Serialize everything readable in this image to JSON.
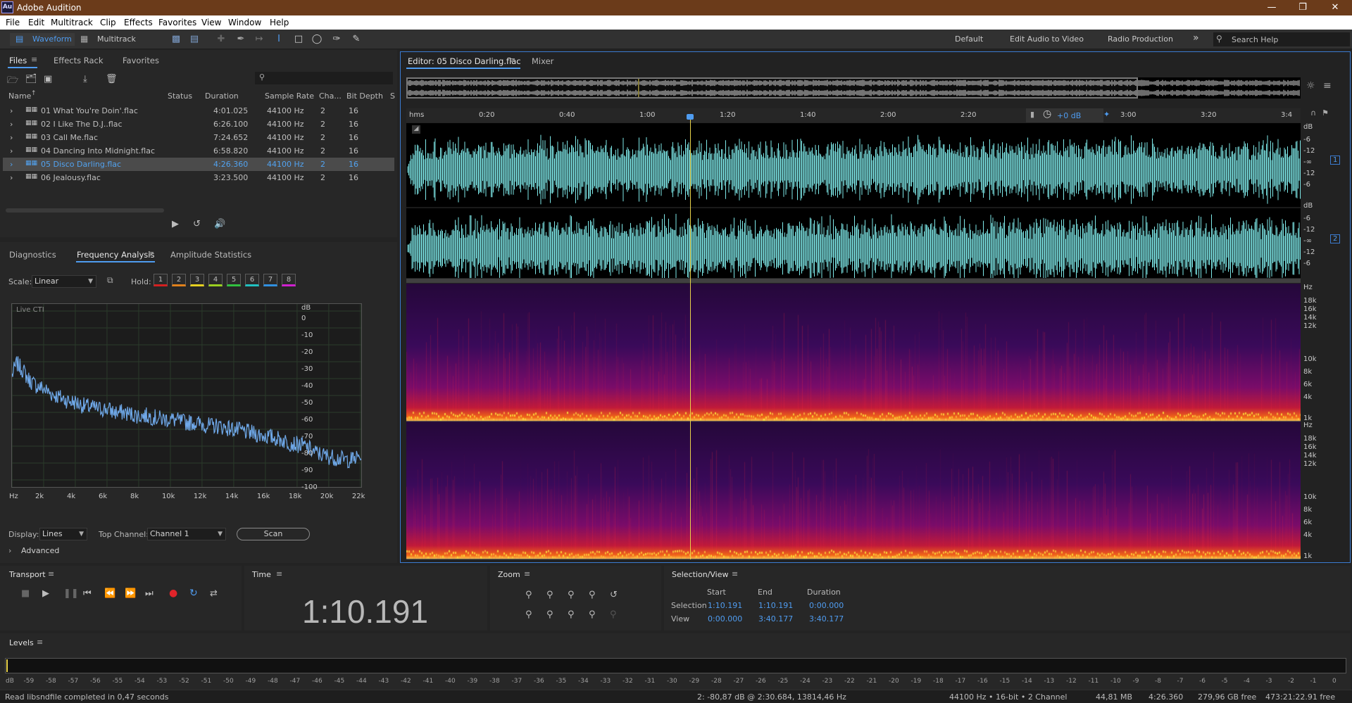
{
  "app": {
    "title": "Adobe Audition",
    "logo_text": "Au",
    "window_controls": [
      "minimize-icon",
      "maximize-icon",
      "close-icon"
    ]
  },
  "menu": [
    "File",
    "Edit",
    "Multitrack",
    "Clip",
    "Effects",
    "Favorites",
    "View",
    "Window",
    "Help"
  ],
  "toolbar": {
    "waveform_label": "Waveform",
    "multitrack_label": "Multitrack",
    "workspaces": [
      "Default",
      "Edit Audio to Video",
      "Radio Production"
    ],
    "search_placeholder": "Search Help"
  },
  "files_panel": {
    "tabs": [
      "Files",
      "Effects Rack",
      "Favorites"
    ],
    "search_placeholder": "",
    "columns": [
      "Name",
      "Status",
      "Duration",
      "Sample Rate",
      "Cha...",
      "Bit Depth",
      "S"
    ],
    "rows": [
      {
        "name": "01 What You're Doin'.flac",
        "status": "",
        "duration": "4:01.025",
        "sample_rate": "44100 Hz",
        "channels": "2",
        "bit_depth": "16"
      },
      {
        "name": "02 I Like The D.J..flac",
        "status": "",
        "duration": "6:26.100",
        "sample_rate": "44100 Hz",
        "channels": "2",
        "bit_depth": "16"
      },
      {
        "name": "03 Call Me.flac",
        "status": "",
        "duration": "7:24.652",
        "sample_rate": "44100 Hz",
        "channels": "2",
        "bit_depth": "16"
      },
      {
        "name": "04 Dancing Into Midnight.flac",
        "status": "",
        "duration": "6:58.820",
        "sample_rate": "44100 Hz",
        "channels": "2",
        "bit_depth": "16"
      },
      {
        "name": "05 Disco Darling.flac",
        "status": "",
        "duration": "4:26.360",
        "sample_rate": "44100 Hz",
        "channels": "2",
        "bit_depth": "16",
        "selected": true
      },
      {
        "name": "06 Jealousy.flac",
        "status": "",
        "duration": "3:23.500",
        "sample_rate": "44100 Hz",
        "channels": "2",
        "bit_depth": "16"
      }
    ]
  },
  "analysis_panel": {
    "tabs": [
      "Diagnostics",
      "Frequency Analysis",
      "Amplitude Statistics"
    ],
    "scale_label": "Scale:",
    "scale_value": "Linear",
    "hold_label": "Hold:",
    "hold_buttons": [
      "1",
      "2",
      "3",
      "4",
      "5",
      "6",
      "7",
      "8"
    ],
    "hold_colors": [
      "#d42020",
      "#e0801b",
      "#e6d020",
      "#9bd020",
      "#31c040",
      "#20c0c0",
      "#3090e0",
      "#d020d0"
    ],
    "live_label": "Live CTI",
    "display_label": "Display:",
    "display_value": "Lines",
    "top_channel_label": "Top Channel:",
    "top_channel_value": "Channel 1",
    "scan_label": "Scan",
    "advanced_label": "Advanced"
  },
  "chart_data": {
    "type": "line",
    "title": "",
    "xlabel": "Hz",
    "ylabel": "dB",
    "x_ticks": [
      "Hz",
      "2k",
      "4k",
      "6k",
      "8k",
      "10k",
      "12k",
      "14k",
      "16k",
      "18k",
      "20k",
      "22k"
    ],
    "y_ticks": [
      "dB",
      "0",
      "-10",
      "-20",
      "-30",
      "-40",
      "-50",
      "-60",
      "-70",
      "-80",
      "-90",
      "-100"
    ],
    "xlim": [
      0,
      22050
    ],
    "ylim": [
      -100,
      0
    ],
    "grid": true,
    "series": [
      {
        "x": [
          0,
          300,
          700,
          1000,
          1500,
          2000,
          2500,
          3000,
          3500,
          4000,
          4500,
          5000,
          5500,
          6000,
          6500,
          7000,
          7500,
          8000,
          8500,
          9000,
          9500,
          10000,
          10500,
          11000,
          11500,
          12000,
          12500,
          13000,
          13500,
          14000,
          14500,
          15000,
          15500,
          16000,
          16500,
          17000,
          17500,
          18000,
          18500,
          19000,
          19500,
          20000,
          20500,
          21000,
          21500,
          22000
        ],
        "y": [
          -38,
          -31,
          -35,
          -40,
          -44,
          -46,
          -49,
          -51,
          -53,
          -54,
          -56,
          -57,
          -58,
          -58,
          -60,
          -60,
          -61,
          -62,
          -62,
          -63,
          -64,
          -64,
          -65,
          -66,
          -66,
          -67,
          -68,
          -68,
          -69,
          -70,
          -71,
          -72,
          -73,
          -74,
          -75,
          -76,
          -78,
          -79,
          -80,
          -83,
          -85,
          -86,
          -87,
          -88,
          -88,
          -86
        ]
      }
    ]
  },
  "editor": {
    "tabs": [
      "Editor: 05 Disco Darling.flac",
      "Mixer"
    ],
    "ruler_label": "hms",
    "ruler_ticks": [
      "0:20",
      "0:40",
      "1:00",
      "1:20",
      "1:40",
      "2:00",
      "2:20",
      "3:00",
      "3:20",
      "3:4"
    ],
    "hud_gain": "+0 dB",
    "db_scale_top": [
      "dB",
      "-6",
      "-12",
      "-∞",
      "-12",
      "-6"
    ],
    "db_scale_bottom": [
      "dB",
      "-6",
      "-12",
      "-∞",
      "-12",
      "-6"
    ],
    "hz_scale": [
      "Hz",
      "18k",
      "16k",
      "14k",
      "12k",
      "10k",
      "8k",
      "6k",
      "4k",
      "1k"
    ],
    "channel_tags": [
      "1",
      "2"
    ],
    "playhead_fraction": 0.3175,
    "waveform_color": "#7ee9e9"
  },
  "transport": {
    "title": "Transport"
  },
  "time_panel": {
    "title": "Time",
    "time": "1:10.191"
  },
  "zoom_panel": {
    "title": "Zoom"
  },
  "selection_panel": {
    "title": "Selection/View",
    "headers": [
      "Start",
      "End",
      "Duration"
    ],
    "rows": [
      {
        "label": "Selection",
        "start": "1:10.191",
        "end": "1:10.191",
        "duration": "0:00.000"
      },
      {
        "label": "View",
        "start": "0:00.000",
        "end": "3:40.177",
        "duration": "3:40.177"
      }
    ]
  },
  "levels": {
    "title": "Levels",
    "ticks": [
      "dB",
      "-59",
      "-58",
      "-57",
      "-56",
      "-55",
      "-54",
      "-53",
      "-52",
      "-51",
      "-50",
      "-49",
      "-48",
      "-47",
      "-46",
      "-45",
      "-44",
      "-43",
      "-42",
      "-41",
      "-40",
      "-39",
      "-38",
      "-37",
      "-36",
      "-35",
      "-34",
      "-33",
      "-32",
      "-31",
      "-30",
      "-29",
      "-28",
      "-27",
      "-26",
      "-25",
      "-24",
      "-23",
      "-22",
      "-21",
      "-20",
      "-19",
      "-18",
      "-17",
      "-16",
      "-15",
      "-14",
      "-13",
      "-12",
      "-11",
      "-10",
      "-9",
      "-8",
      "-7",
      "-6",
      "-5",
      "-4",
      "-3",
      "-2",
      "-1",
      "0"
    ]
  },
  "status": {
    "message": "Read libsndfile completed in 0,47 seconds",
    "cursor_info": "2: -80,87 dB @ 2:30.684, 13814,46 Hz",
    "format": "44100 Hz • 16-bit • 2 Channel",
    "size": "44,81 MB",
    "duration": "4:26.360",
    "free_space": "279,96 GB free",
    "free_time": "473:21:22.91 free"
  }
}
